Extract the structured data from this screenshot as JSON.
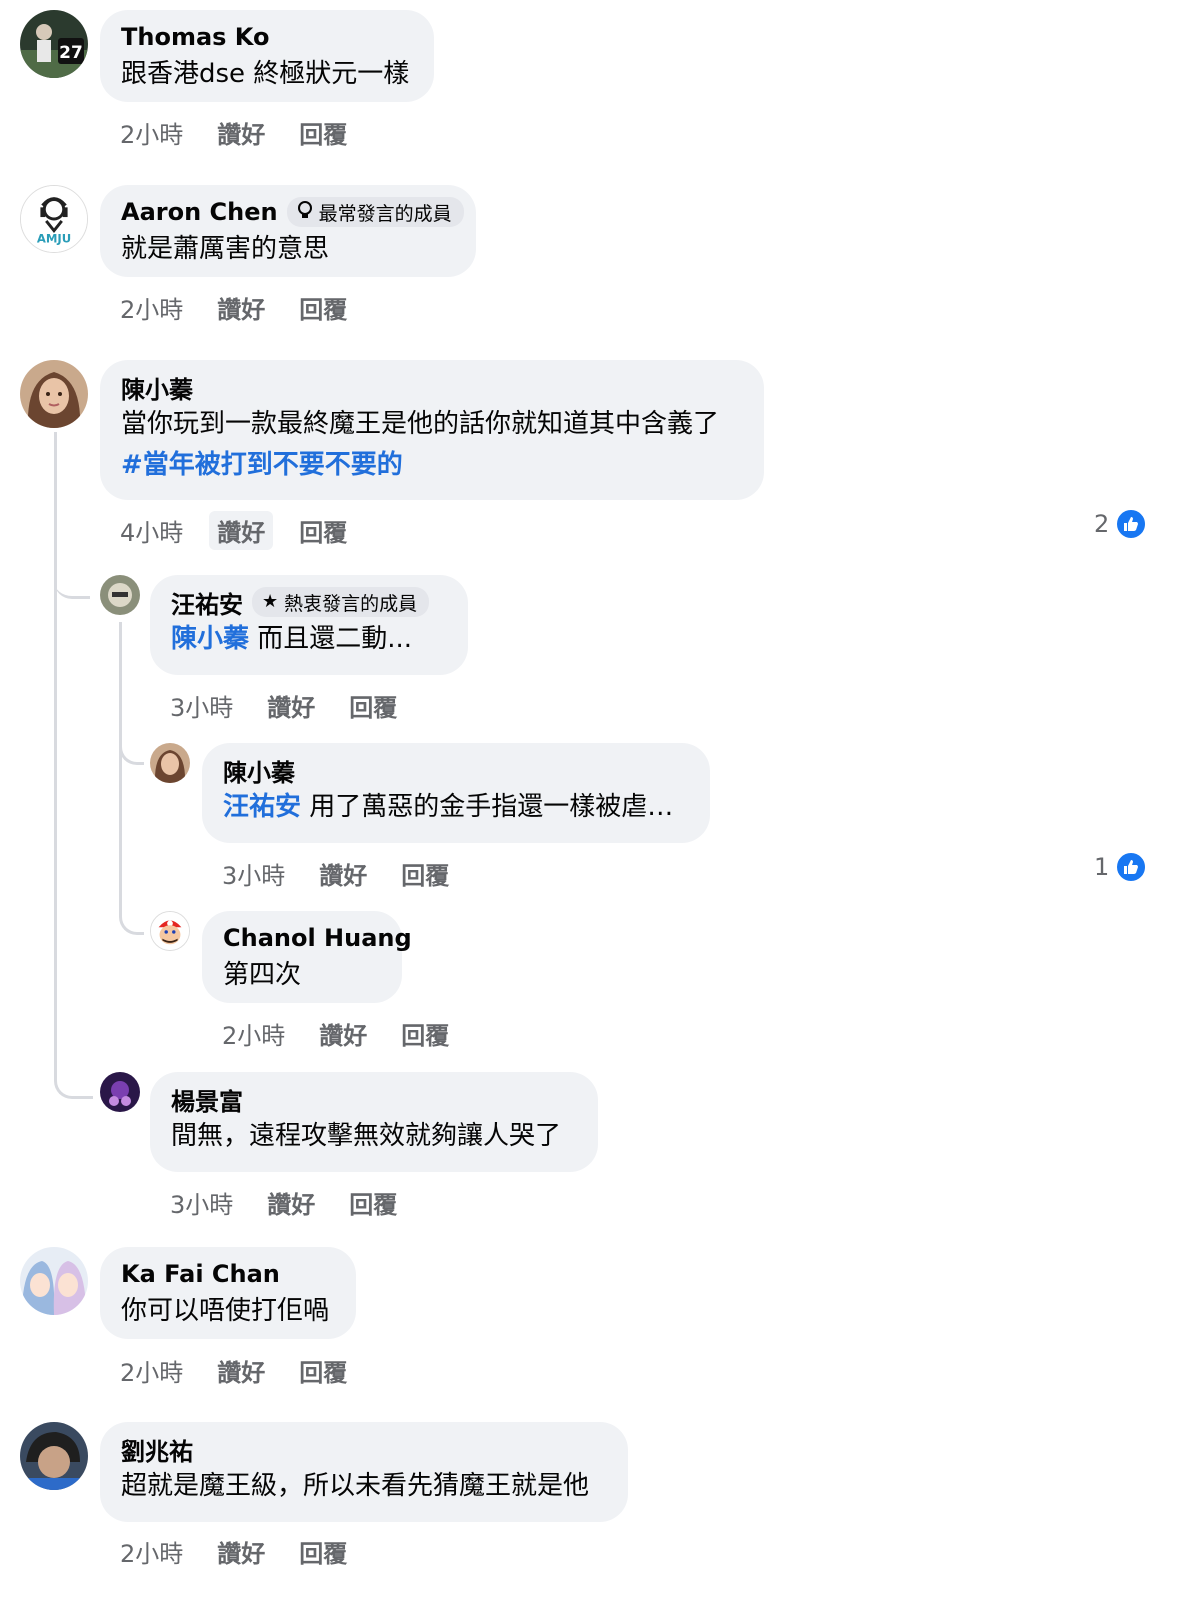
{
  "comments": [
    {
      "name": "Thomas Ko",
      "badge": null,
      "text": "跟香港dse 終極狀元一樣",
      "time": "2小時",
      "like": "讚好",
      "reply": "回覆"
    },
    {
      "name": "Aaron Chen",
      "badge": "最常發言的成員",
      "text": "就是蕭厲害的意思",
      "time": "2小時",
      "like": "讚好",
      "reply": "回覆"
    },
    {
      "name": "陳小蓁",
      "badge": null,
      "text": "當你玩到一款最終魔王是他的話你就知道其中含義了",
      "hashtag": "#當年被打到不要不要的",
      "time": "4小時",
      "like": "讚好",
      "reply": "回覆",
      "reactions": "2"
    },
    {
      "name": "汪祐安",
      "badge": "熱衷發言的成員",
      "mention": "陳小蓁",
      "text": " 而且還二動...",
      "time": "3小時",
      "like": "讚好",
      "reply": "回覆"
    },
    {
      "name": "陳小蓁",
      "badge": null,
      "mention": "汪祐安",
      "text": " 用了萬惡的金手指還一樣被虐…",
      "time": "3小時",
      "like": "讚好",
      "reply": "回覆",
      "reactions": "1"
    },
    {
      "name": "Chanol Huang",
      "badge": null,
      "text": "第四次",
      "time": "2小時",
      "like": "讚好",
      "reply": "回覆"
    },
    {
      "name": "楊景富",
      "badge": null,
      "text": "間無，遠程攻擊無效就夠讓人哭了",
      "time": "3小時",
      "like": "讚好",
      "reply": "回覆"
    },
    {
      "name": "Ka Fai Chan",
      "badge": null,
      "text": "你可以唔使打佢喎",
      "time": "2小時",
      "like": "讚好",
      "reply": "回覆"
    },
    {
      "name": "劉兆祐",
      "badge": null,
      "text": "超就是魔王級，所以未看先猜魔王就是他",
      "time": "2小時",
      "like": "讚好",
      "reply": "回覆"
    }
  ],
  "icons": {
    "badge_top": "lightbulb-icon",
    "badge_star": "star-icon",
    "reaction": "like-icon"
  },
  "colors": {
    "bubble": "#f0f2f5",
    "link": "#216fdb",
    "meta": "#65676b",
    "reaction": "#1877f2"
  },
  "avatars": {
    "a0_jersey": "27"
  }
}
